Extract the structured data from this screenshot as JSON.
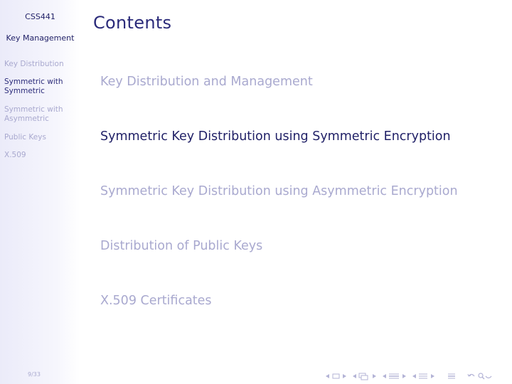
{
  "sidebar": {
    "course": "CSS441",
    "lecture": "Key Management",
    "sections": [
      {
        "label": "Key Distribution"
      },
      {
        "label": "Symmetric with Symmetric"
      },
      {
        "label": "Symmetric with Asymmetric"
      },
      {
        "label": "Public Keys"
      },
      {
        "label": "X.509"
      }
    ],
    "active_section_index": 1,
    "page": "9/33"
  },
  "main": {
    "title": "Contents",
    "toc": [
      {
        "label": "Key Distribution and Management"
      },
      {
        "label": "Symmetric Key Distribution using Symmetric Encryption"
      },
      {
        "label": "Symmetric Key Distribution using Asymmetric Encryption"
      },
      {
        "label": "Distribution of Public Keys"
      },
      {
        "label": "X.509 Certificates"
      }
    ],
    "active_toc_index": 1
  },
  "navigation": {
    "controls": [
      {
        "icon": "slide-nav-icon"
      },
      {
        "icon": "frame-nav-icon"
      },
      {
        "icon": "subsection-nav-icon"
      },
      {
        "icon": "section-nav-icon"
      },
      {
        "icon": "appendix-nav-icon"
      },
      {
        "icon": "search-nav-icon"
      }
    ]
  },
  "colors": {
    "structure": "#2b2b7a",
    "dim": "#a9a9cf",
    "sidebar_bg": "#ebebf9"
  }
}
